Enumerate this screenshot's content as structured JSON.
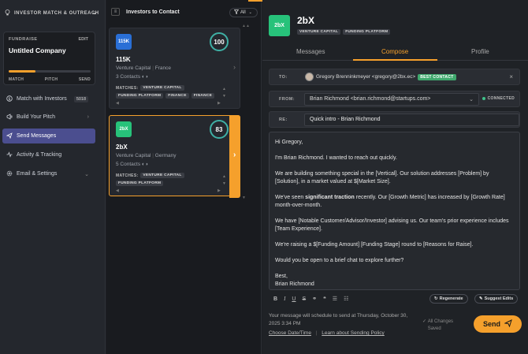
{
  "sidebar": {
    "header": "INVESTOR MATCH & OUTREACH",
    "fundraise": {
      "label": "FUNDRAISE",
      "edit": "EDIT",
      "title": "Untitled Company",
      "progress": 0.33,
      "steps": [
        "MATCH",
        "PITCH",
        "SEND"
      ]
    },
    "items": [
      {
        "label": "Match with Investors",
        "badge": "5018"
      },
      {
        "label": "Build Your Pitch"
      },
      {
        "label": "Send Messages"
      },
      {
        "label": "Activity & Tracking"
      },
      {
        "label": "Email & Settings"
      }
    ]
  },
  "middle": {
    "title": "Investors to Contact",
    "filter": "All",
    "cards": [
      {
        "logo_text": "115K",
        "logo_color": "#2a6fd6",
        "name": "115K",
        "firm": "Venture Capital",
        "location": "France",
        "contacts": "3 Contacts",
        "score": "100",
        "matches_label": "MATCHES:",
        "tags": [
          "VENTURE CAPITAL",
          "FUNDING PLATFORM",
          "FINANCE",
          "FINANCE"
        ]
      },
      {
        "logo_text": "2bX",
        "logo_color": "#27c27a",
        "name": "2bX",
        "firm": "Venture Capital",
        "location": "Germany",
        "contacts": "5 Contacts",
        "score": "83",
        "matches_label": "MATCHES:",
        "tags": [
          "VENTURE CAPITAL",
          "FUNDING PLATFORM"
        ]
      }
    ]
  },
  "investor": {
    "logo_text": "2bX",
    "name": "2bX",
    "tags": [
      "VENTURE CAPITAL",
      "FUNDING PLATFORM"
    ]
  },
  "tabs": [
    "Messages",
    "Compose",
    "Profile"
  ],
  "compose": {
    "to_label": "TO:",
    "to_contact": "Gregory Brenninkmeyer <gregory@2bx.ec>",
    "to_badge": "BEST CONTACT",
    "from_label": "FROM:",
    "from_value": "Brian Richmond <brian.richmond@startups.com>",
    "connected": "CONNECTED",
    "re_label": "RE:",
    "subject": "Quick intro - Brian Richmond",
    "body": {
      "p1": "Hi Gregory,",
      "p2": "I'm Brian Richmond. I wanted to reach out quickly.",
      "p3": "We are building something special in the [Vertical]. Our solution addresses [Problem] by [Solution], in a market valued at $[Market Size].",
      "p4_pre": "We've seen ",
      "p4_bold": "significant traction",
      "p4_post": " recently. Our [Growth Metric] has increased by [Growth Rate] month-over-month.",
      "p5": "We have [Notable Customer/Advisor/Investor] advising us. Our team's prior experience includes [Team Experience].",
      "p6": "We're raising a $[Funding Amount] [Funding Stage] round to [Reasons for Raise].",
      "p7": "Would you be open to a brief chat to explore further?",
      "p8a": "Best,",
      "p8b": "Brian Richmond"
    },
    "regenerate": "Regenerate",
    "suggest": "Suggest Edits",
    "schedule_msg": "Your message will schedule to send at Thursday, October 30, 2025 3:34 PM",
    "choose_link": "Choose Date/Time",
    "policy_link": "Learn about Sending Policy",
    "saved": "All Changes Saved",
    "send": "Send"
  }
}
